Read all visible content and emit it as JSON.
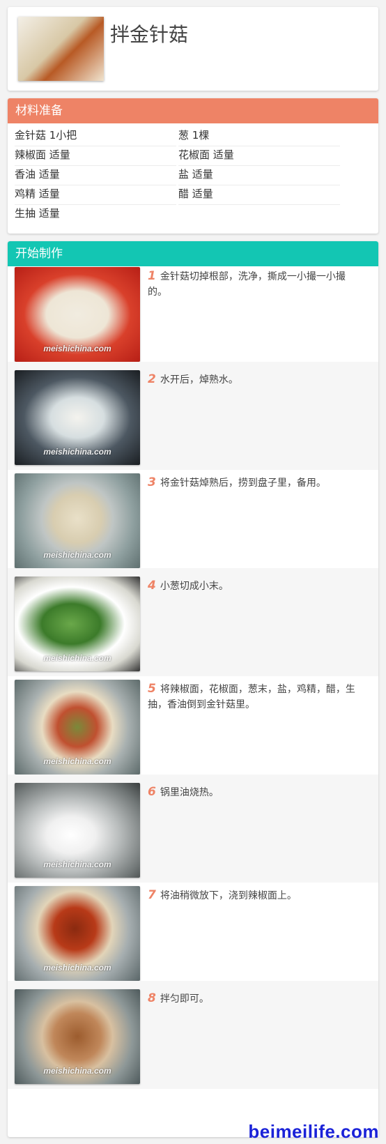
{
  "header": {
    "title": "拌金针菇"
  },
  "ingredients": {
    "heading": "材料准备",
    "items": [
      "金针菇 1小把",
      "葱 1棵",
      "辣椒面 适量",
      "花椒面 适量",
      "香油 适量",
      "盐 适量",
      "鸡精 适量",
      "醋 适量",
      "生抽 适量"
    ]
  },
  "steps": {
    "heading": "开始制作",
    "watermark": "meishichina.com",
    "items": [
      {
        "num": "1",
        "text": "金针菇切掉根部，洗净，撕成一小撮一小撮的。"
      },
      {
        "num": "2",
        "text": "水开后，焯熟水。"
      },
      {
        "num": "3",
        "text": "将金针菇焯熟后，捞到盘子里，备用。"
      },
      {
        "num": "4",
        "text": "小葱切成小末。"
      },
      {
        "num": "5",
        "text": "将辣椒面，花椒面，葱末，盐，鸡精，醋，生抽，香油倒到金针菇里。"
      },
      {
        "num": "6",
        "text": "锅里油烧热。"
      },
      {
        "num": "7",
        "text": "将油稍微放下，浇到辣椒面上。"
      },
      {
        "num": "8",
        "text": "拌匀即可。"
      }
    ]
  },
  "site_watermark": "beimeilife.com"
}
